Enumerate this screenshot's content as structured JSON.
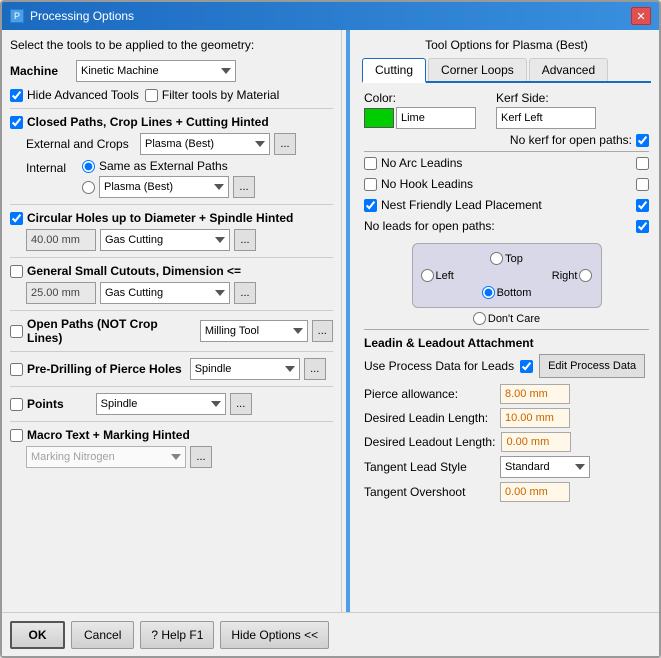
{
  "window": {
    "title": "Processing Options",
    "icon": "P"
  },
  "left": {
    "instruction": "Select the tools to be applied to the geometry:",
    "machine_label": "Machine",
    "machine_value": "Kinetic Machine",
    "hide_advanced_tools": "Hide Advanced Tools",
    "filter_by_material": "Filter tools by Material",
    "closed_paths_header": "Closed Paths,  Crop Lines  +  Cutting Hinted",
    "external_crops_label": "External and Crops",
    "external_crops_value": "Plasma (Best)",
    "internal_label": "Internal",
    "internal_radio1": "Same as External Paths",
    "internal_radio2": "Plasma (Best)",
    "circular_holes_header": "Circular Holes up to Diameter  +  Spindle Hinted",
    "circular_diameter": "40.00 mm",
    "circular_tool": "Gas Cutting",
    "general_small_header": "General Small Cutouts, Dimension <=",
    "general_small_dim": "25.00 mm",
    "general_small_tool": "Gas Cutting",
    "open_paths_header": "Open Paths\n(NOT Crop Lines)",
    "open_paths_tool": "Milling Tool",
    "predrilling_header": "Pre-Drilling of\nPierce Holes",
    "predrilling_tool": "Spindle",
    "points_header": "Points",
    "points_tool": "Spindle",
    "macro_text_header": "Macro Text  +  Marking Hinted",
    "macro_text_tool": "Marking Nitrogen"
  },
  "right": {
    "title": "Tool Options for Plasma (Best)",
    "tabs": [
      "Cutting",
      "Corner Loops",
      "Advanced"
    ],
    "active_tab": "Cutting",
    "color_label": "Color:",
    "color_value": "Lime",
    "kerf_label": "Kerf Side:",
    "kerf_value": "Kerf Left",
    "no_kerf_label": "No kerf for open paths:",
    "no_arc_leadins": "No Arc Leadins",
    "no_hook_leadins": "No Hook Leadins",
    "nest_friendly": "Nest Friendly Lead Placement",
    "no_leads_open": "No leads for open paths:",
    "lead_positions": {
      "top": "Top",
      "left": "Left",
      "right": "Right",
      "bottom": "Bottom"
    },
    "dont_care": "Don't Care",
    "leadin_section_title": "Leadin & Leadout Attachment",
    "use_process_label": "Use Process Data for Leads",
    "edit_process_btn": "Edit Process Data",
    "pierce_label": "Pierce allowance:",
    "pierce_value": "8.00 mm",
    "leadin_label": "Desired Leadin Length:",
    "leadin_value": "10.00 mm",
    "leadout_label": "Desired Leadout Length:",
    "leadout_value": "0.00 mm",
    "tangent_style_label": "Tangent Lead Style",
    "tangent_style_value": "Standard",
    "tangent_overshoot_label": "Tangent Overshoot",
    "tangent_overshoot_value": "0.00 mm"
  },
  "footer": {
    "ok": "OK",
    "cancel": "Cancel",
    "help": "? Help F1",
    "hide_options": "Hide Options <<"
  }
}
